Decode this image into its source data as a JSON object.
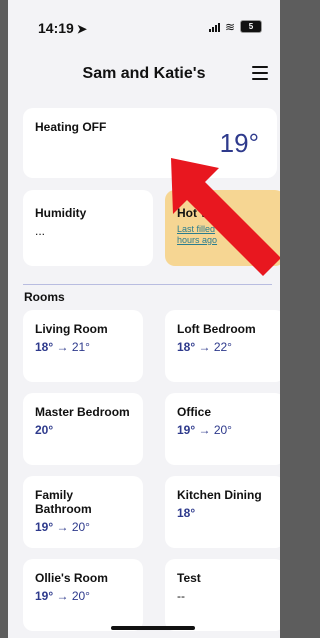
{
  "status_bar": {
    "time": "14:19",
    "battery": "5"
  },
  "header": {
    "title": "Sam and Katie's"
  },
  "heating": {
    "label": "Heating OFF",
    "temperature": "19°"
  },
  "humidity": {
    "label": "Humidity",
    "value": "..."
  },
  "hot_water": {
    "label": "Hot W",
    "sub_line1": "Last filled",
    "sub_line2": "hours ago"
  },
  "rooms_label": "Rooms",
  "rooms": [
    {
      "name": "Living Room",
      "current": "18°",
      "target": "→ 21°"
    },
    {
      "name": "Loft Bedroom",
      "current": "18°",
      "target": "→ 22°"
    },
    {
      "name": "Master Bedroom",
      "current": "20°",
      "target": ""
    },
    {
      "name": "Office",
      "current": "19°",
      "target": "→ 20°"
    },
    {
      "name": "Family Bathroom",
      "current": "19°",
      "target": "→ 20°"
    },
    {
      "name": "Kitchen Dining",
      "current": "18°",
      "target": ""
    },
    {
      "name": "Ollie's Room",
      "current": "19°",
      "target": "→ 20°"
    },
    {
      "name": "Test",
      "current": "--",
      "target": ""
    }
  ],
  "colors": {
    "accent": "#2e3a8c",
    "hot_water_bg": "#f6d693",
    "annotation_arrow": "#e8171f"
  }
}
